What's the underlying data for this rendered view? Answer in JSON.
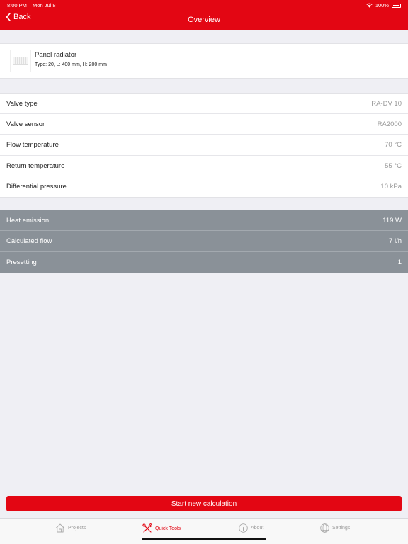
{
  "status": {
    "time": "8:00 PM",
    "date": "Mon Jul 8",
    "battery": "100%"
  },
  "nav": {
    "back_label": "Back",
    "title": "Overview"
  },
  "product": {
    "name": "Panel radiator",
    "details": "Type: 20, L: 400 mm, H: 200 mm"
  },
  "params": [
    {
      "label": "Valve type",
      "value": "RA-DV 10"
    },
    {
      "label": "Valve sensor",
      "value": "RA2000"
    },
    {
      "label": "Flow temperature",
      "value": "70 °C"
    },
    {
      "label": "Return temperature",
      "value": "55 °C"
    },
    {
      "label": "Differential pressure",
      "value": "10 kPa"
    }
  ],
  "results": [
    {
      "label": "Heat emission",
      "value": "119 W"
    },
    {
      "label": "Calculated flow",
      "value": "7 l/h"
    },
    {
      "label": "Presetting",
      "value": "1"
    }
  ],
  "start_button": "Start new calculation",
  "tabs": [
    {
      "label": "Projects",
      "icon": "house-icon"
    },
    {
      "label": "Quick Tools",
      "icon": "tools-icon",
      "active": true
    },
    {
      "label": "About",
      "icon": "info-icon"
    },
    {
      "label": "Settings",
      "icon": "globe-icon"
    }
  ],
  "colors": {
    "accent": "#e30613",
    "results_bg": "#8a9198",
    "background": "#efeff4"
  }
}
